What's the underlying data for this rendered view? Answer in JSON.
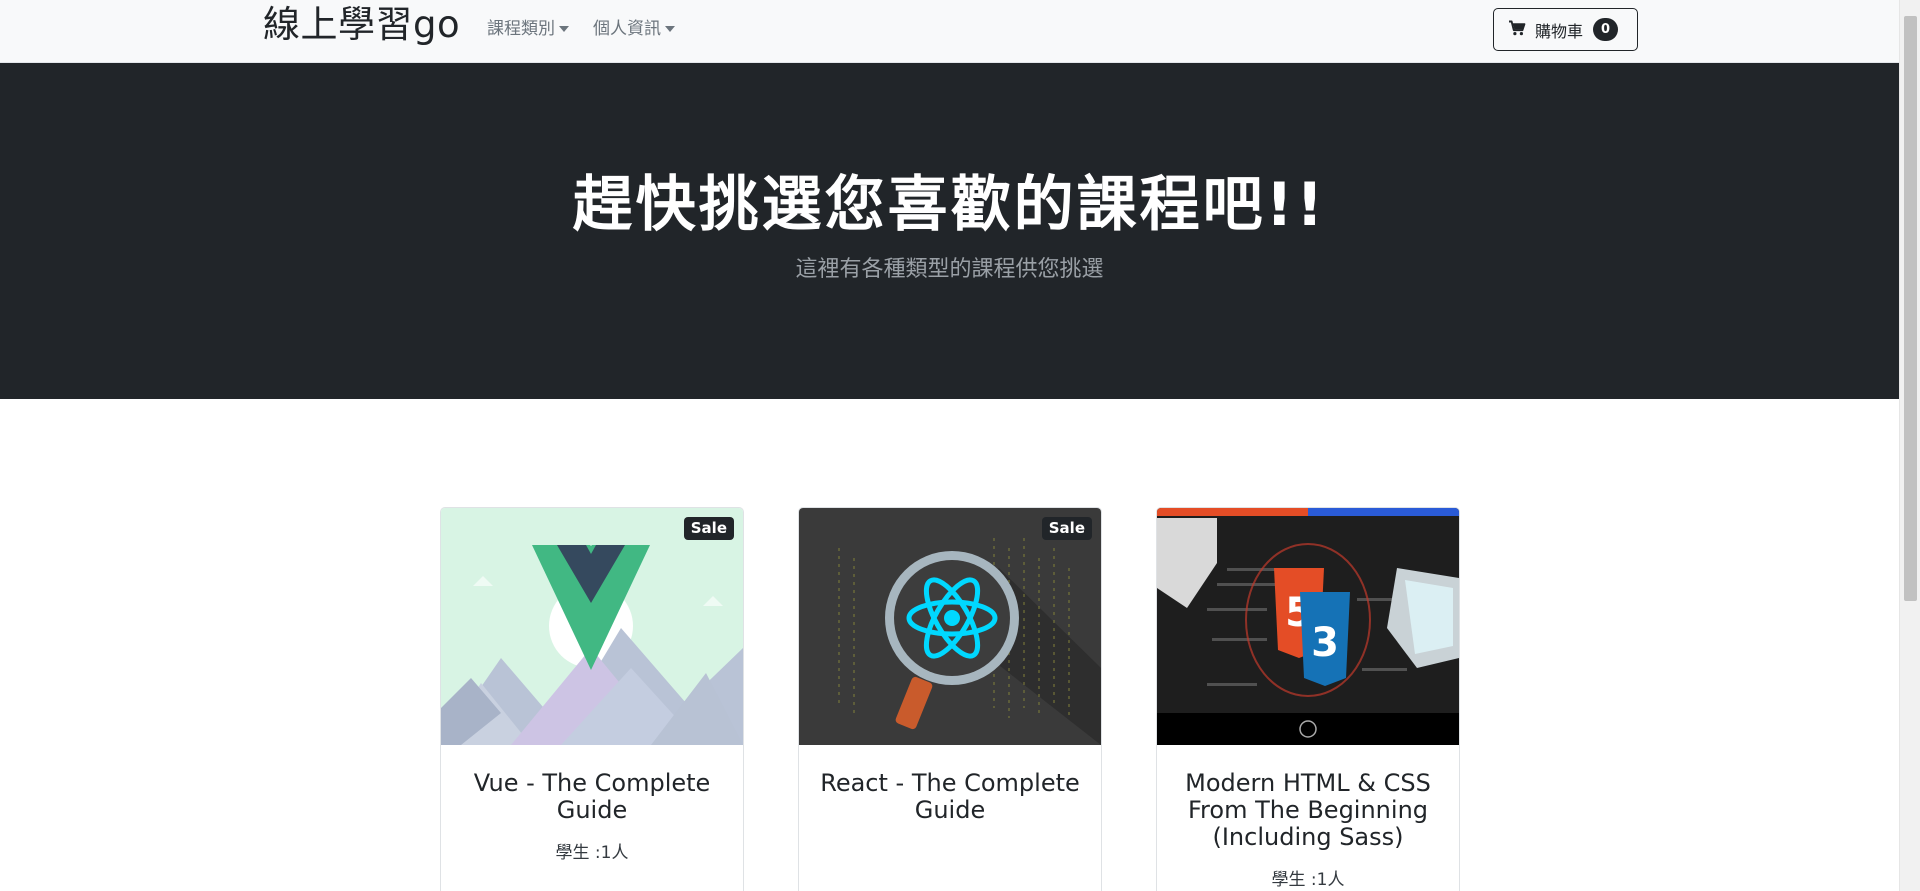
{
  "navbar": {
    "brand": "線上學習go",
    "menu": [
      {
        "label": "課程類別"
      },
      {
        "label": "個人資訊"
      }
    ],
    "cart": {
      "label": "購物車",
      "count": "0"
    }
  },
  "hero": {
    "title": "趕快挑選您喜歡的課程吧!!",
    "subtitle": "這裡有各種類型的課程供您挑選"
  },
  "courses": [
    {
      "title": "Vue - The Complete Guide",
      "badge": "Sale",
      "students": "學生 :1人",
      "image_icon": "vue-logo"
    },
    {
      "title": "React - The Complete Guide",
      "badge": "Sale",
      "students": "",
      "image_icon": "react-logo"
    },
    {
      "title": "Modern HTML & CSS From The Beginning (Including Sass)",
      "badge": "",
      "students": "學生 :1人",
      "image_icon": "html-css-logo"
    }
  ],
  "colors": {
    "navbar_bg": "#f8f9fa",
    "hero_bg": "#212529",
    "badge_bg": "#212529",
    "vue_green": "#41b883",
    "vue_dark": "#35495e",
    "react_blue": "#00d8ff"
  }
}
